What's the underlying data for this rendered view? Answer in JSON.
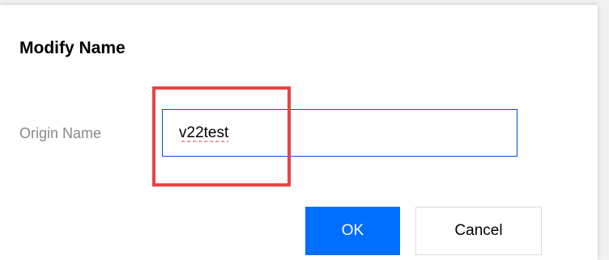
{
  "dialog": {
    "title": "Modify Name",
    "field": {
      "label": "Origin Name",
      "value": "v22test"
    },
    "buttons": {
      "ok_label": "OK",
      "cancel_label": "Cancel"
    }
  },
  "colors": {
    "primary": "#006eff",
    "input_border": "#0052d9",
    "highlight": "#e54545",
    "label": "#888888"
  }
}
